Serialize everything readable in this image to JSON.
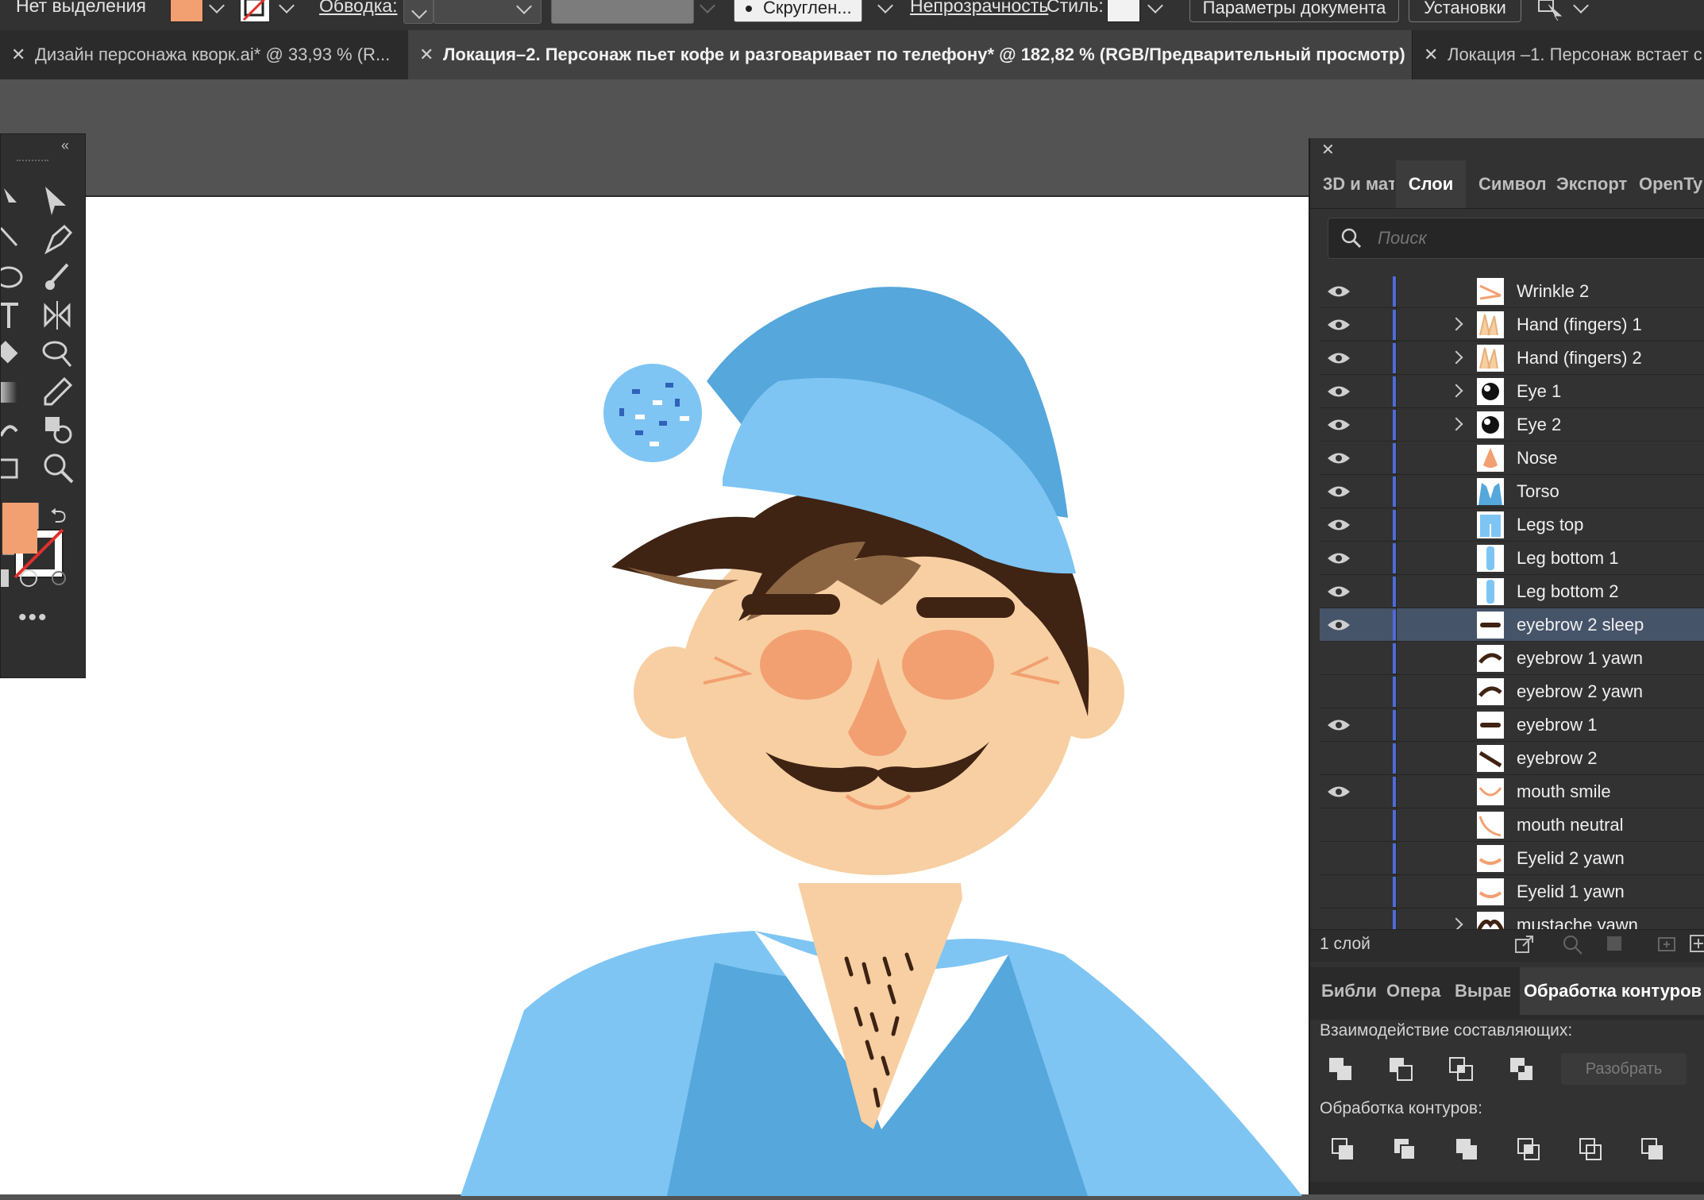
{
  "control_bar": {
    "selection_status": "Нет выделения",
    "stroke_label": "Обводка:",
    "brush_label": "Скруглен...",
    "opacity_label": "Непрозрачность",
    "style_label": "Стиль:",
    "doc_settings_button": "Параметры документа",
    "prefs_button": "Установки",
    "fill_color": "#f2a071"
  },
  "tabs": [
    {
      "label": "Дизайн персонажа кворк.ai* @ 33,93 % (R..."
    },
    {
      "label": "Локация–2. Персонаж пьет кофе и разговаривает по телефону* @ 182,82 % (RGB/Предварительный просмотр)"
    },
    {
      "label": "Локация –1. Персонаж встает с"
    }
  ],
  "panel": {
    "tabs": [
      "3D и мат",
      "Слои",
      "Символ",
      "Экспорт",
      "OpenTy"
    ],
    "active_tab": "Слои",
    "search_placeholder": "Поиск",
    "layers": [
      {
        "name": "Wrinkle 2",
        "visible": true,
        "expandable": false,
        "thumb": "wrinkle"
      },
      {
        "name": "Hand (fingers) 1",
        "visible": true,
        "expandable": true,
        "thumb": "hand"
      },
      {
        "name": "Hand (fingers) 2",
        "visible": true,
        "expandable": true,
        "thumb": "hand"
      },
      {
        "name": "Eye 1",
        "visible": true,
        "expandable": true,
        "thumb": "eye"
      },
      {
        "name": "Eye 2",
        "visible": true,
        "expandable": true,
        "thumb": "eye"
      },
      {
        "name": "Nose",
        "visible": true,
        "expandable": false,
        "thumb": "nose"
      },
      {
        "name": "Torso",
        "visible": true,
        "expandable": false,
        "thumb": "torso"
      },
      {
        "name": "Legs top",
        "visible": true,
        "expandable": false,
        "thumb": "legs"
      },
      {
        "name": "Leg bottom 1",
        "visible": true,
        "expandable": false,
        "thumb": "leg"
      },
      {
        "name": "Leg bottom 2",
        "visible": true,
        "expandable": false,
        "thumb": "leg"
      },
      {
        "name": "eyebrow 2 sleep",
        "visible": true,
        "expandable": false,
        "thumb": "brow-flat",
        "selected": true
      },
      {
        "name": "eyebrow 1 yawn",
        "visible": false,
        "expandable": false,
        "thumb": "brow-arc"
      },
      {
        "name": "eyebrow 2 yawn",
        "visible": false,
        "expandable": false,
        "thumb": "brow-arc"
      },
      {
        "name": "eyebrow 1",
        "visible": true,
        "expandable": false,
        "thumb": "brow-flat"
      },
      {
        "name": "eyebrow 2",
        "visible": false,
        "expandable": false,
        "thumb": "brow-tilt"
      },
      {
        "name": "mouth smile",
        "visible": true,
        "expandable": false,
        "thumb": "mouth-smile"
      },
      {
        "name": "mouth neutral",
        "visible": false,
        "expandable": false,
        "thumb": "mouth-neutral"
      },
      {
        "name": "Eyelid 2 yawn",
        "visible": false,
        "expandable": false,
        "thumb": "eyelid"
      },
      {
        "name": "Eyelid 1 yawn",
        "visible": false,
        "expandable": false,
        "thumb": "eyelid"
      },
      {
        "name": "mustache yawn",
        "visible": false,
        "expandable": true,
        "thumb": "mustache"
      }
    ],
    "layer_count": "1 слой",
    "bottom_tabs": [
      "Библи",
      "Опера",
      "Вырав",
      "Обработка контуров"
    ],
    "bottom_active_tab": "Обработка контуров",
    "shape_modes_label": "Взаимодействие составляющих:",
    "expand_button": "Разобрать",
    "pathfinders_label": "Обработка контуров:"
  }
}
